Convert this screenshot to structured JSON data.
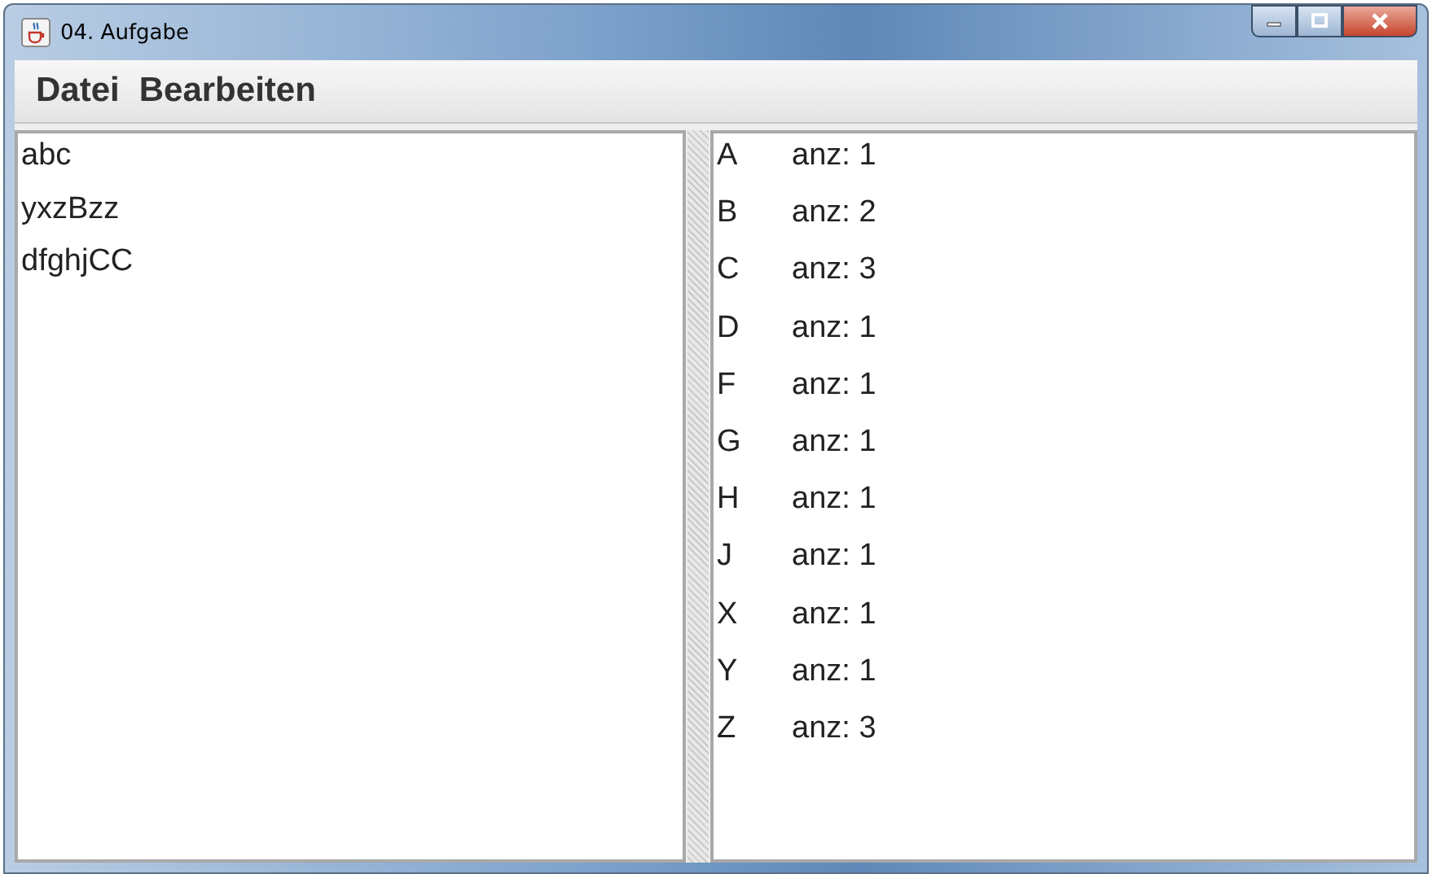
{
  "window": {
    "title": "04. Aufgabe"
  },
  "menu": [
    "Datei",
    "Bearbeiten"
  ],
  "editor": {
    "lines": [
      "abc",
      "yxzBzz",
      "dfghjCC"
    ]
  },
  "counts": [
    {
      "letter": "A",
      "count": "anz: 1"
    },
    {
      "letter": "B",
      "count": "anz: 2"
    },
    {
      "letter": "C",
      "count": "anz: 3"
    },
    {
      "letter": "D",
      "count": "anz: 1"
    },
    {
      "letter": "F",
      "count": "anz: 1"
    },
    {
      "letter": "G",
      "count": "anz: 1"
    },
    {
      "letter": "H",
      "count": "anz: 1"
    },
    {
      "letter": "J",
      "count": "anz: 1"
    },
    {
      "letter": "X",
      "count": "anz: 1"
    },
    {
      "letter": "Y",
      "count": "anz: 1"
    },
    {
      "letter": "Z",
      "count": "anz: 3"
    }
  ]
}
